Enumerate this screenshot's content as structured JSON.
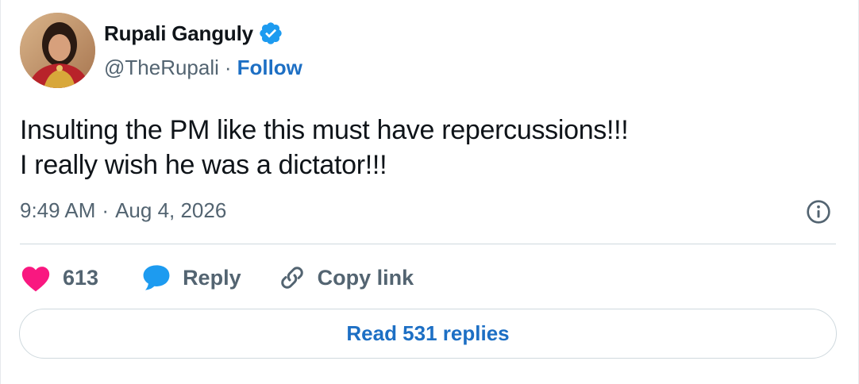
{
  "author": {
    "display_name": "Rupali Ganguly",
    "handle": "@TheRupali",
    "separator": "·",
    "follow_label": "Follow",
    "verified": true
  },
  "tweet": {
    "lines": [
      "Insulting the PM like this must have repercussions!!!",
      "I really wish he was a dictator!!!"
    ],
    "time": "9:49 AM",
    "date_separator": "·",
    "date": "Aug 4, 2026"
  },
  "actions": {
    "like_count": "613",
    "reply_label": "Reply",
    "copy_link_label": "Copy link"
  },
  "read_replies_label": "Read 531 replies",
  "colors": {
    "link_blue": "#1d6fc4",
    "verified_blue": "#1d9bf0",
    "heart_pink": "#f91880",
    "secondary_text": "#536471"
  },
  "icons": [
    "verified-badge-icon",
    "info-icon",
    "heart-icon",
    "reply-bubble-icon",
    "link-icon"
  ]
}
